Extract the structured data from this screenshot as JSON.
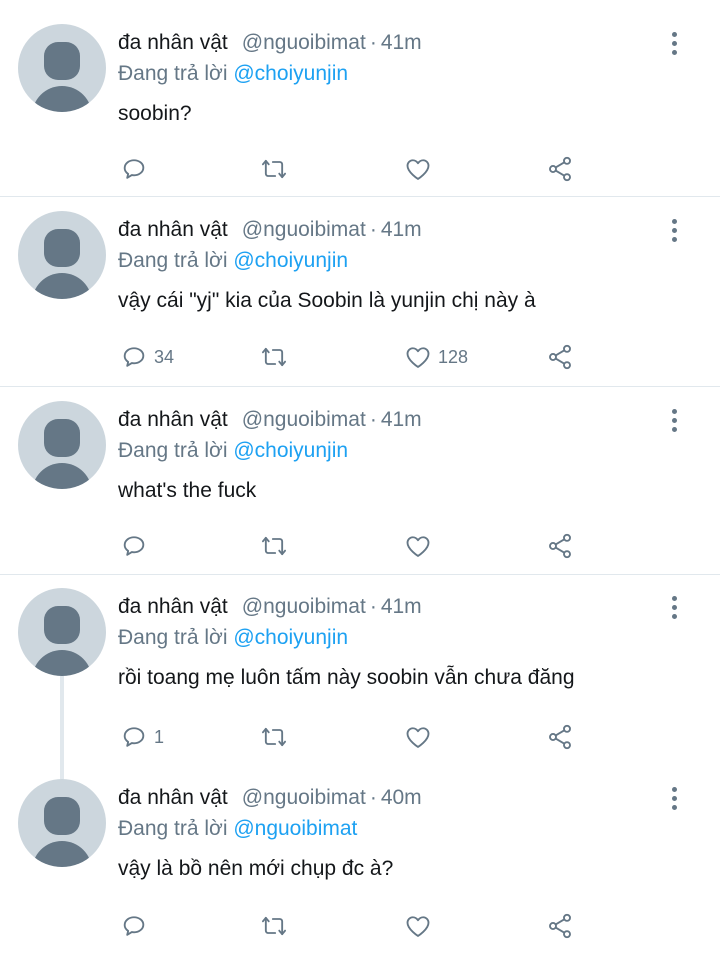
{
  "tweets": [
    {
      "name": "đa nhân vật",
      "handle": "@nguoibimat",
      "separator": "·",
      "time": "41m",
      "replying_prefix": "Đang trả lời",
      "replying_to": "@choiyunjin",
      "text": "soobin?",
      "reply_count": "",
      "retweet_count": "",
      "like_count": ""
    },
    {
      "name": "đa nhân vật",
      "handle": "@nguoibimat",
      "separator": "·",
      "time": "41m",
      "replying_prefix": "Đang trả lời",
      "replying_to": "@choiyunjin",
      "text": "vậy cái \"yj\" kia của Soobin là yunjin chị này à",
      "reply_count": "34",
      "retweet_count": "",
      "like_count": "128"
    },
    {
      "name": "đa nhân vật",
      "handle": "@nguoibimat",
      "separator": "·",
      "time": "41m",
      "replying_prefix": "Đang trả lời",
      "replying_to": "@choiyunjin",
      "text": "what's the fuck",
      "reply_count": "",
      "retweet_count": "",
      "like_count": ""
    },
    {
      "name": "đa nhân vật",
      "handle": "@nguoibimat",
      "separator": "·",
      "time": "41m",
      "replying_prefix": "Đang trả lời",
      "replying_to": "@choiyunjin",
      "text": "rồi toang mẹ luôn tấm này soobin vẫn chưa đăng",
      "reply_count": "1",
      "retweet_count": "",
      "like_count": ""
    },
    {
      "name": "đa nhân vật",
      "handle": "@nguoibimat",
      "separator": "·",
      "time": "40m",
      "replying_prefix": "Đang trả lời",
      "replying_to": "@nguoibimat",
      "text": "vậy là bồ nên mới chụp đc à?",
      "reply_count": "",
      "retweet_count": "",
      "like_count": ""
    }
  ],
  "icons": {
    "reply": "reply-icon",
    "retweet": "retweet-icon",
    "like": "heart-icon",
    "share": "share-icon",
    "more": "more-vertical-icon"
  },
  "colors": {
    "text": "#14171a",
    "muted": "#657786",
    "link": "#1da1f2",
    "divider": "#e1e8ed",
    "avatar_bg": "#ccd6dd"
  }
}
